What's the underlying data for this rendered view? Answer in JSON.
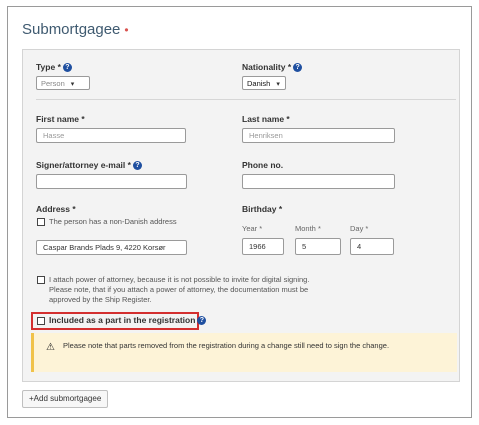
{
  "section": {
    "title": "Submortgagee",
    "required_marker": "•"
  },
  "form": {
    "type": {
      "label": "Type",
      "value": "Person"
    },
    "nationality": {
      "label": "Nationality",
      "value": "Danish"
    },
    "first_name": {
      "label": "First name",
      "value": "Hasse"
    },
    "last_name": {
      "label": "Last name",
      "value": "Henriksen"
    },
    "email": {
      "label": "Signer/attorney e-mail",
      "value": ""
    },
    "phone": {
      "label": "Phone no.",
      "value": ""
    },
    "address": {
      "label": "Address",
      "non_danish_label": "The person has a non-Danish address",
      "value": "Caspar Brands Plads 9, 4220 Korsør"
    },
    "birthday": {
      "label": "Birthday",
      "year_label": "Year",
      "year": "1966",
      "month_label": "Month",
      "month": "5",
      "day_label": "Day",
      "day": "4"
    },
    "power_of_attorney": "I attach power of attorney, because it is not possible to invite for digital signing. Please note, that if you attach a power of attorney, the documentation must be approved by the Ship Register.",
    "included_label": "Included as a part in the registration",
    "warning": "Please note that parts removed from the registration during a change still need to sign the change."
  },
  "add_button": "+Add submortgagee",
  "icons": {
    "help": "help-circle-icon",
    "warning": "warning-triangle-icon",
    "chevron": "chevron-down-icon"
  },
  "colors": {
    "title": "#3f5a70",
    "highlight": "#d32f2f",
    "warning_bg": "#fdf3d7",
    "help": "#1f4fa0"
  }
}
